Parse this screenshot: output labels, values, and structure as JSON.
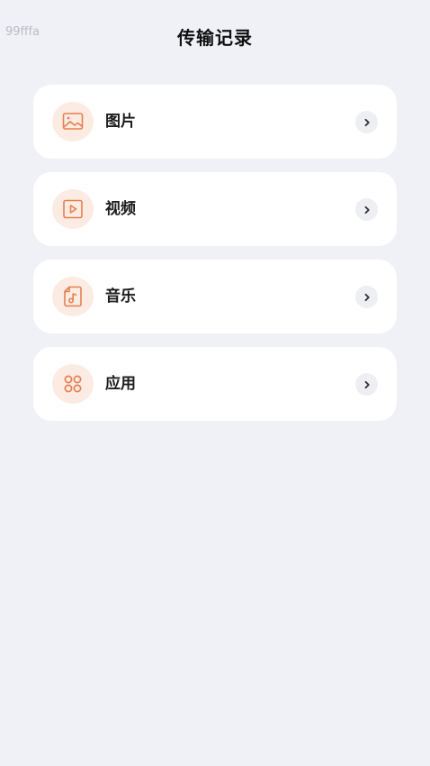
{
  "watermark": "99fffa",
  "header": {
    "title": "传输记录"
  },
  "colors": {
    "background": "#f0f1f6",
    "card": "#ffffff",
    "accent": "#e5804f",
    "icon_bg": "#fcebe2",
    "chevron_bg": "#eeeff3"
  },
  "categories": [
    {
      "label": "图片",
      "icon": "image-icon"
    },
    {
      "label": "视频",
      "icon": "video-play-icon"
    },
    {
      "label": "音乐",
      "icon": "music-file-icon"
    },
    {
      "label": "应用",
      "icon": "apps-grid-icon"
    }
  ]
}
